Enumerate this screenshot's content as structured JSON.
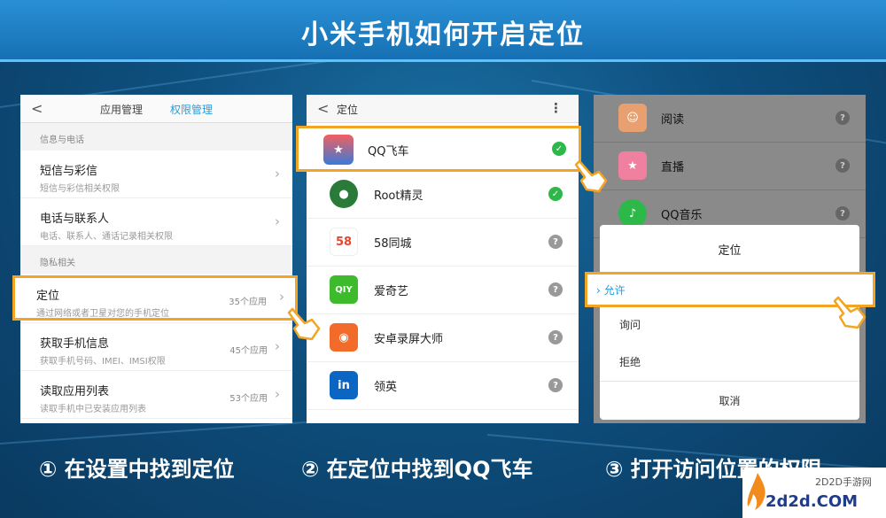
{
  "header": {
    "title": "小米手机如何开启定位"
  },
  "phone1": {
    "back": "<",
    "tab_app_manage": "应用管理",
    "tab_permission_manage": "权限管理",
    "section_info": "信息与电话",
    "rows_top": [
      {
        "main": "短信与彩信",
        "sub": "短信与彩信相关权限"
      },
      {
        "main": "电话与联系人",
        "sub": "电话、联系人、通话记录相关权限"
      }
    ],
    "section_privacy": "隐私相关",
    "location_row": {
      "main": "定位",
      "sub": "通过网络或者卫星对您的手机定位",
      "count": "35个应用"
    },
    "rows_bottom": [
      {
        "main": "获取手机信息",
        "sub": "获取手机号码、IMEI、IMSI权限",
        "count": "45个应用"
      },
      {
        "main": "读取应用列表",
        "sub": "读取手机中已安装应用列表",
        "count": "53个应用"
      }
    ]
  },
  "phone2": {
    "back": "<",
    "title": "定位",
    "menu": "⋮",
    "highlight_app": {
      "name": "QQ飞车"
    },
    "apps": [
      {
        "name": "Root精灵",
        "icon_color": "#2a7a3a",
        "status": "ok"
      },
      {
        "name": "58同城",
        "icon_text": "58",
        "icon_color": "#ffffff",
        "status": "q"
      },
      {
        "name": "爱奇艺",
        "icon_text": "QIY",
        "icon_color": "#3dbb2c",
        "status": "q"
      },
      {
        "name": "安卓录屏大师",
        "icon_color": "#f26b2a",
        "status": "q"
      },
      {
        "name": "领英",
        "icon_text": "in",
        "icon_color": "#0a66c2",
        "status": "q"
      }
    ]
  },
  "phone3": {
    "apps": [
      {
        "name": "阅读",
        "icon_color": "#e8a070"
      },
      {
        "name": "直播",
        "icon_color": "#f080a0"
      },
      {
        "name": "QQ音乐",
        "icon_color": "#2db84a"
      }
    ],
    "dialog": {
      "title": "定位",
      "allow": "允许",
      "ask": "询问",
      "deny": "拒绝",
      "cancel": "取消"
    }
  },
  "steps": {
    "s1": "① 在设置中找到定位",
    "s2": "② 在定位中找到QQ飞车",
    "s3": "③ 打开访问位置的权限"
  },
  "logo": {
    "cn": "2D2D手游网",
    "en": "2d2d.COM"
  },
  "colors": {
    "accent": "#f2a524",
    "link": "#2a9cd8",
    "ok": "#2db84a"
  }
}
